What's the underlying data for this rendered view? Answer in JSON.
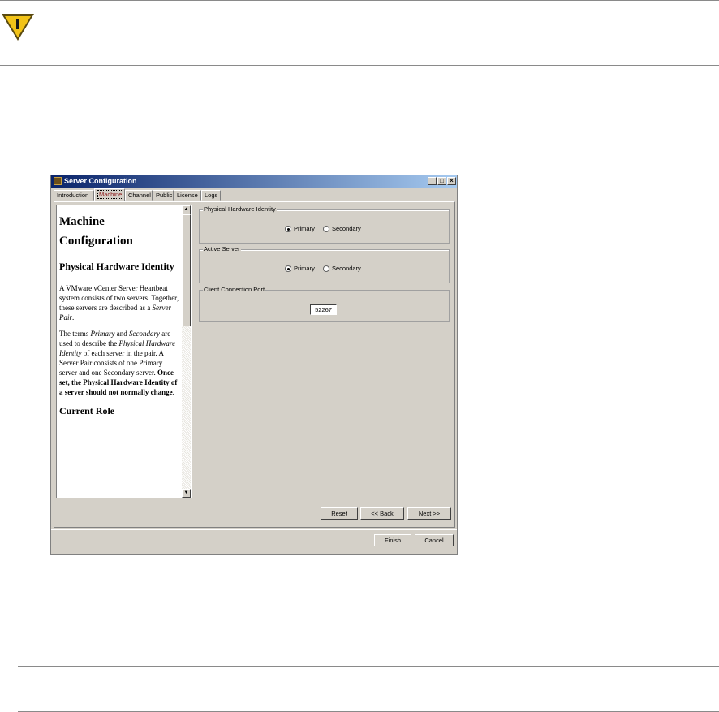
{
  "window": {
    "title": "Server Configuration",
    "controls": {
      "minimize": "_",
      "maximize": "□",
      "close": "×"
    }
  },
  "tabs": [
    {
      "label": "Introduction",
      "active": false
    },
    {
      "label": "Machine",
      "active": true
    },
    {
      "label": "Channel",
      "active": false
    },
    {
      "label": "Public",
      "active": false
    },
    {
      "label": "License",
      "active": false
    },
    {
      "label": "Logs",
      "active": false
    }
  ],
  "help": {
    "title": "Machine Configuration",
    "heading1": "Physical Hardware Identity",
    "para1_a": "A VMware vCenter Server Heartbeat system consists of two servers. Together, these servers are described as a ",
    "para1_em": "Server Pair",
    "para1_end": ".",
    "para2_a": "The terms ",
    "para2_em1": "Primary",
    "para2_b": " and ",
    "para2_em2": "Secondary",
    "para2_c": " are used to describe the ",
    "para2_em3": "Physical Hardware Identity",
    "para2_d": " of each server in the pair. A Server Pair consists of one Primary server and one Secondary server. ",
    "para2_strong": "Once set, the Physical Hardware Identity of a server should not normally change",
    "para2_end": ".",
    "heading2": "Current Role"
  },
  "groups": {
    "hardware_identity": {
      "label": "Physical Hardware Identity",
      "primary": "Primary",
      "secondary": "Secondary",
      "selected": "Primary"
    },
    "active_server": {
      "label": "Active Server",
      "primary": "Primary",
      "secondary": "Secondary",
      "selected": "Primary"
    },
    "client_port": {
      "label": "Client Connection Port",
      "value": "52267"
    }
  },
  "buttons": {
    "reset": "Reset",
    "back": "<< Back",
    "next": "Next >>",
    "finish": "Finish",
    "cancel": "Cancel"
  },
  "colors": {
    "warning": "#f2c318",
    "titlebar_start": "#0a246a",
    "titlebar_end": "#a6caf0",
    "window_bg": "#d4d0c8"
  }
}
